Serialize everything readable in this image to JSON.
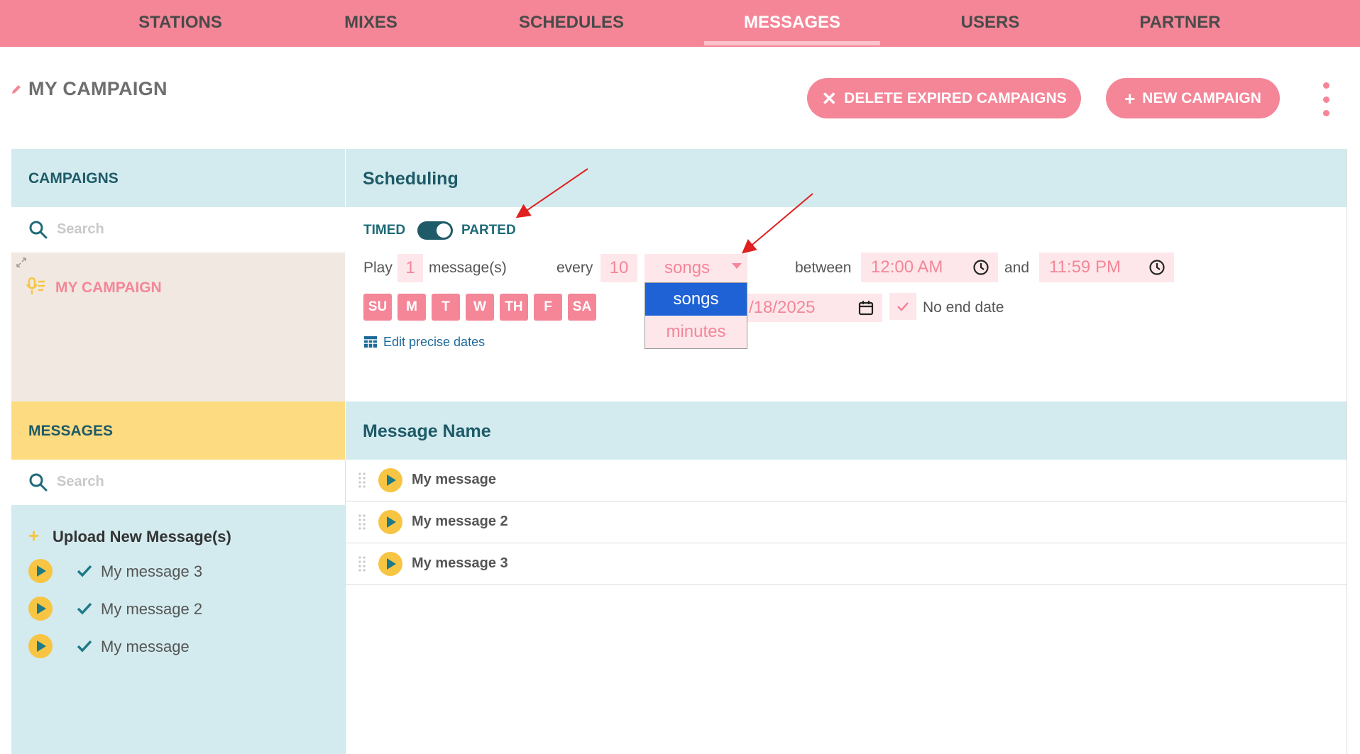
{
  "nav": {
    "tabs": [
      {
        "label": "STATIONS"
      },
      {
        "label": "MIXES"
      },
      {
        "label": "SCHEDULES"
      },
      {
        "label": "MESSAGES"
      },
      {
        "label": "USERS"
      },
      {
        "label": "PARTNER"
      }
    ],
    "active_tab": "MESSAGES"
  },
  "header": {
    "title": "MY CAMPAIGN",
    "delete_expired_label": "DELETE EXPIRED CAMPAIGNS",
    "new_campaign_label": "NEW CAMPAIGN"
  },
  "campaigns_panel": {
    "title": "CAMPAIGNS",
    "search_placeholder": "Search",
    "items": [
      {
        "label": "MY CAMPAIGN"
      }
    ]
  },
  "scheduling": {
    "title": "Scheduling",
    "toggle_left": "TIMED",
    "toggle_right": "PARTED",
    "play_label": "Play",
    "play_count": "1",
    "messages_label": "message(s)",
    "every_label": "every",
    "every_value": "10",
    "unit_selected": "songs",
    "unit_options": [
      "songs",
      "minutes"
    ],
    "between_label": "between",
    "start_time": "12:00 AM",
    "and_label": "and",
    "end_time": "11:59 PM",
    "days": [
      "SU",
      "M",
      "T",
      "W",
      "TH",
      "F",
      "SA"
    ],
    "end_date_partial": "/18/2025",
    "no_end_date_label": "No end date",
    "edit_dates_label": "Edit precise dates"
  },
  "messages_panel": {
    "title": "MESSAGES",
    "search_placeholder": "Search",
    "upload_label": "Upload New Message(s)",
    "library": [
      {
        "label": "My message 3"
      },
      {
        "label": "My message 2"
      },
      {
        "label": "My message"
      }
    ]
  },
  "campaign_messages": {
    "column_title": "Message Name",
    "rows": [
      {
        "name": "My message"
      },
      {
        "name": "My message 2"
      },
      {
        "name": "My message 3"
      }
    ]
  },
  "colors": {
    "brand_pink": "#f48698",
    "header_blue": "#d3ebee",
    "header_yellow": "#fddb80",
    "teal_text": "#1e5a68",
    "selected_option": "#1e62d6",
    "annotation_arrow": "#e02020"
  }
}
